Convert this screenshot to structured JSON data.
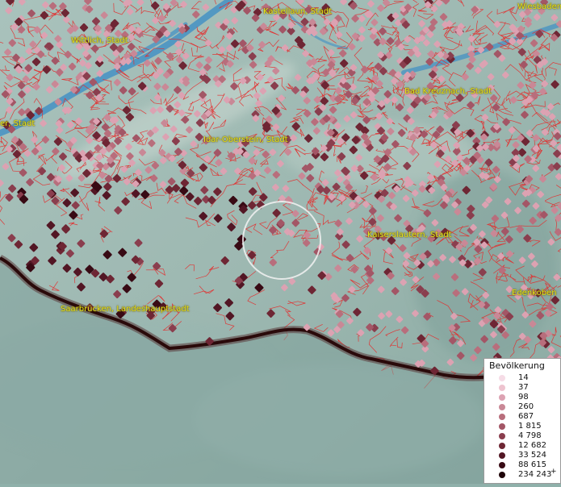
{
  "map": {
    "cities": [
      {
        "id": "kastellaun",
        "label": "Kastellaun, Stadt"
      },
      {
        "id": "wiesbaden",
        "label": "Wiesbaden"
      },
      {
        "id": "wittlich",
        "label": "Wittlich, Stadt"
      },
      {
        "id": "bad-kreuznach",
        "label": "Bad Kreuznach, Stadt"
      },
      {
        "id": "trier",
        "label": "er, Stadt"
      },
      {
        "id": "idar-oberstein",
        "label": "Idar-Oberstein, Stadt"
      },
      {
        "id": "kaiserslautern",
        "label": "Kaiserslautern, Stadt"
      },
      {
        "id": "edenkoben",
        "label": "Edenkoben"
      },
      {
        "id": "saarbruecken",
        "label": "Saarbrücken, Landeshauptstadt"
      }
    ],
    "colors": {
      "terrain": "#8fb0aa",
      "river": "#3f8fc4",
      "boundary": "#e62a2a",
      "border": "#2a0a0a",
      "label": "#e6e21c"
    }
  },
  "legend": {
    "title": "Bevölkerung",
    "items": [
      {
        "label": "14",
        "color": "#f6dce6"
      },
      {
        "label": "37",
        "color": "#eec3cf"
      },
      {
        "label": "98",
        "color": "#dca2b2"
      },
      {
        "label": "260",
        "color": "#c98896"
      },
      {
        "label": "687",
        "color": "#b86e7c"
      },
      {
        "label": "1 815",
        "color": "#a35666"
      },
      {
        "label": "4 798",
        "color": "#8a3e4e"
      },
      {
        "label": "12 682",
        "color": "#6e2634"
      },
      {
        "label": "33 524",
        "color": "#521624"
      },
      {
        "label": "88 615",
        "color": "#380a14"
      },
      {
        "label": "234 243",
        "color": "#1e0408"
      }
    ],
    "overflow_mark": "+"
  }
}
